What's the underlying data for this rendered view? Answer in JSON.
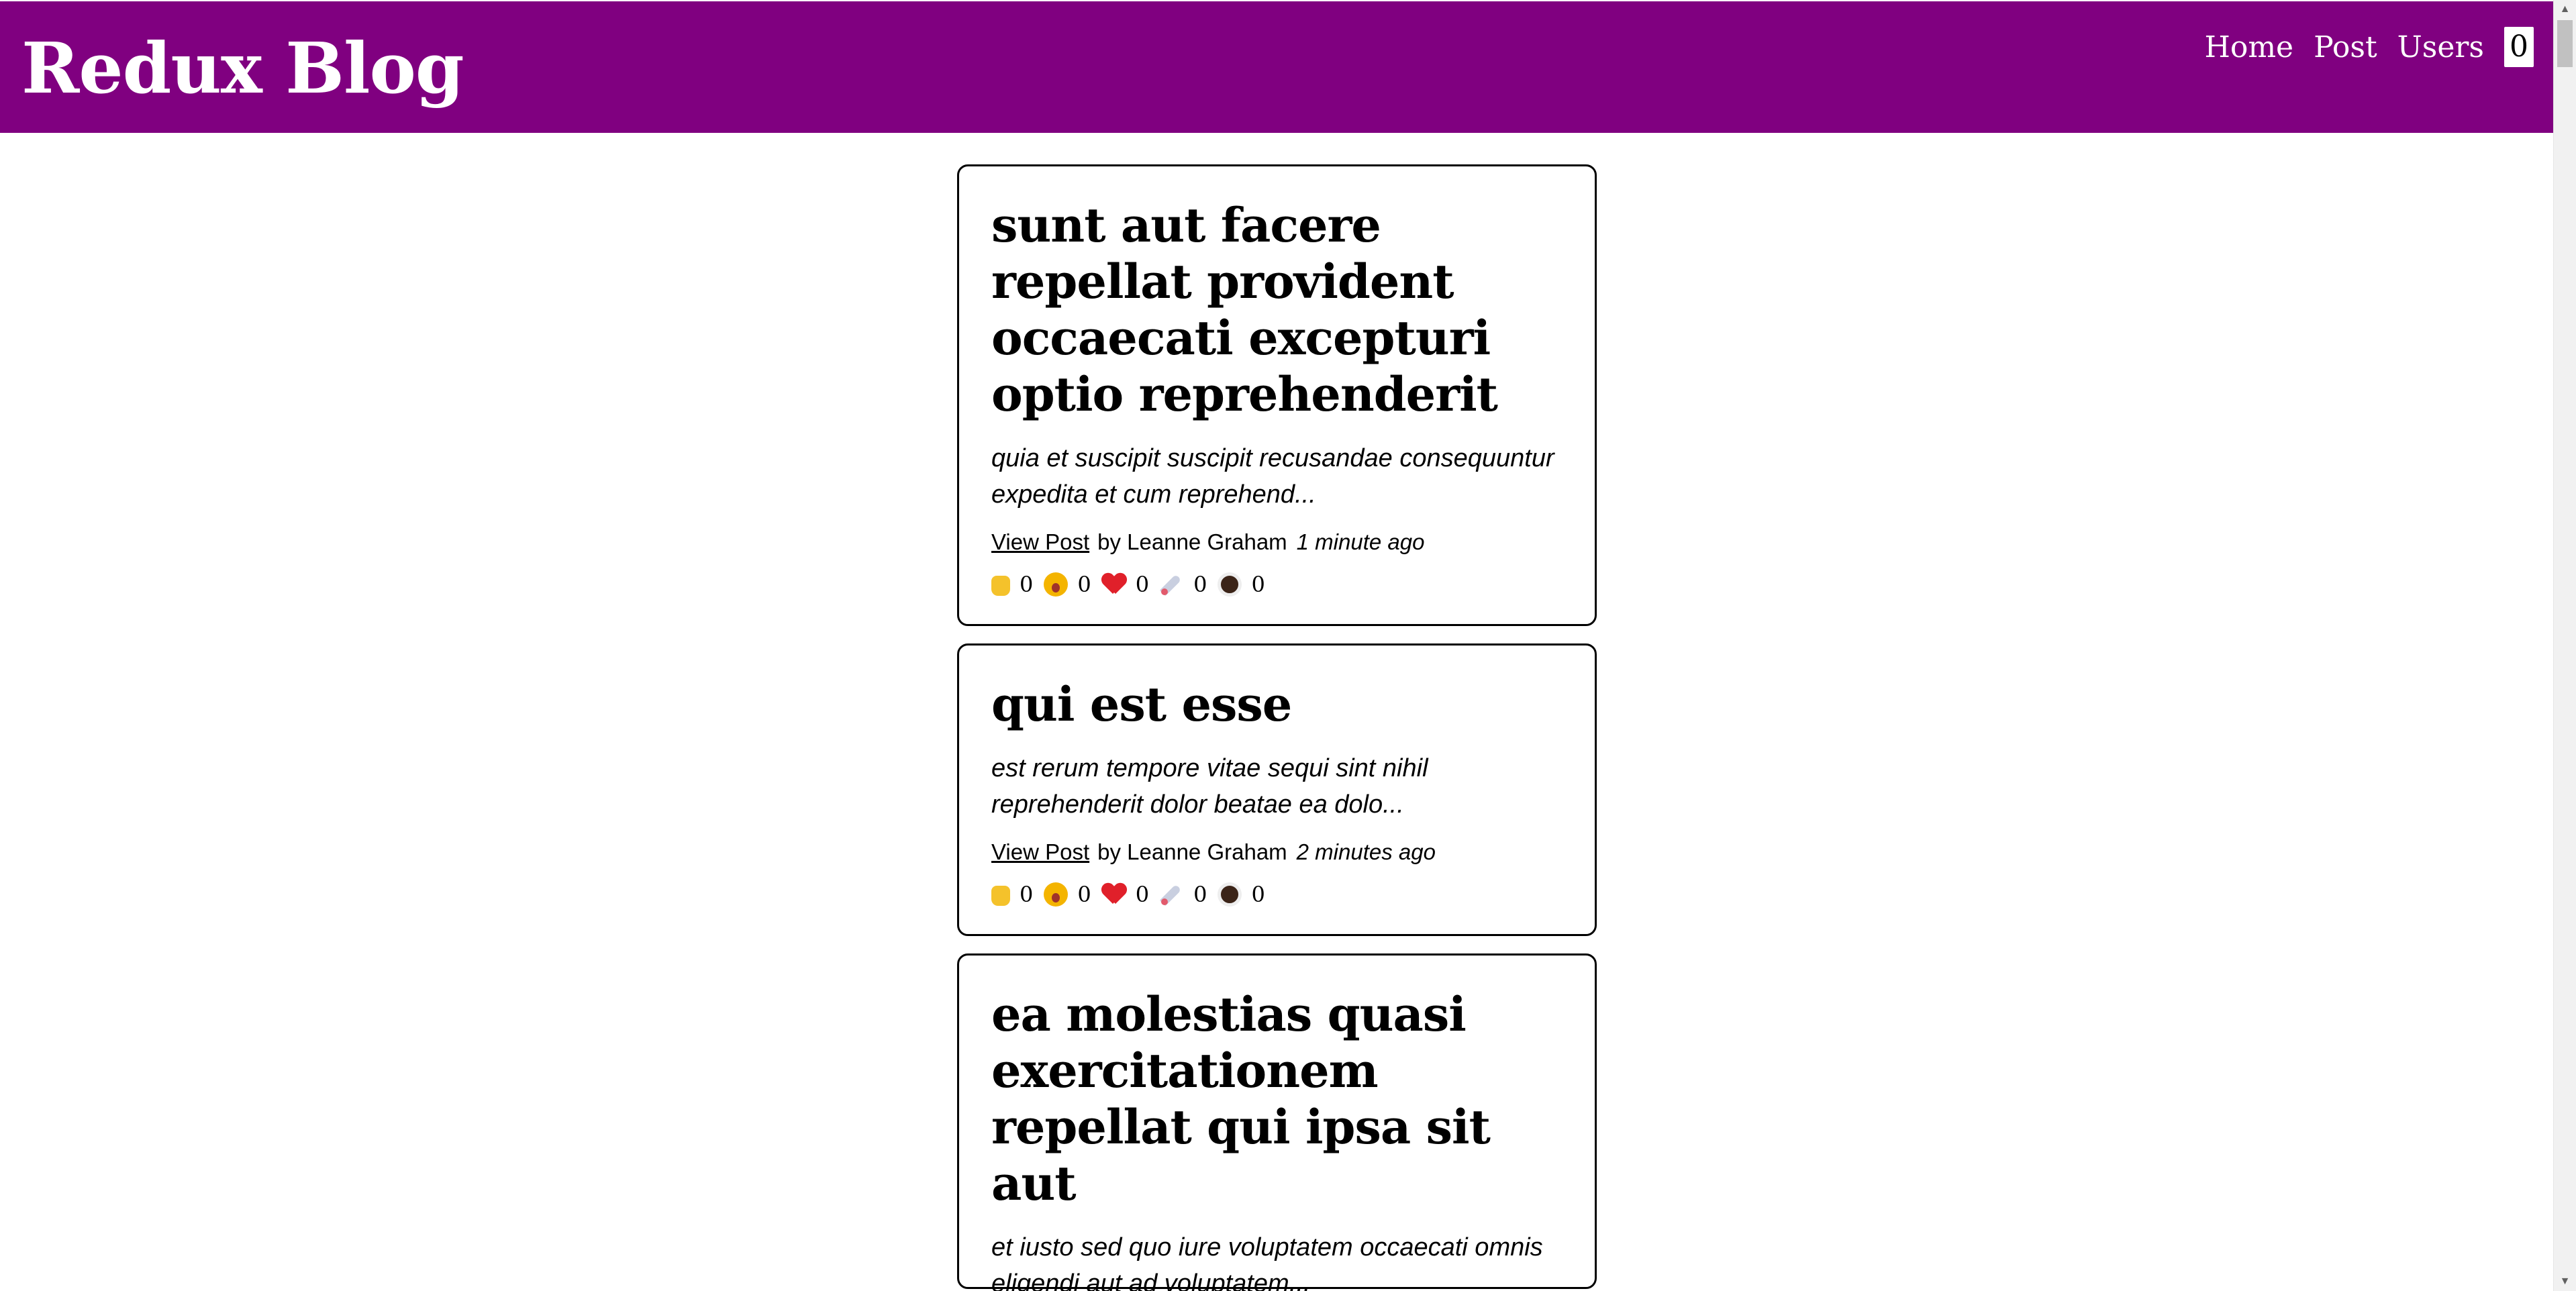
{
  "header": {
    "title": "Redux Blog",
    "nav": [
      {
        "label": "Home"
      },
      {
        "label": "Post"
      },
      {
        "label": "Users"
      }
    ],
    "count": "0"
  },
  "posts": [
    {
      "title": "sunt aut facere repellat provident occaecati excepturi optio reprehenderit",
      "excerpt": "quia et suscipit suscipit recusandae consequuntur expedita et cum reprehend...",
      "view_label": "View Post",
      "author": "by Leanne Graham",
      "time": "1 minute ago",
      "reactions": [
        {
          "icon": "thumbs-up-icon",
          "count": "0"
        },
        {
          "icon": "wow-face-icon",
          "count": "0"
        },
        {
          "icon": "heart-icon",
          "count": "0"
        },
        {
          "icon": "rocket-icon",
          "count": "0"
        },
        {
          "icon": "coffee-icon",
          "count": "0"
        }
      ]
    },
    {
      "title": "qui est esse",
      "excerpt": "est rerum tempore vitae sequi sint nihil reprehenderit dolor beatae ea dolo...",
      "view_label": "View Post",
      "author": "by Leanne Graham",
      "time": "2 minutes ago",
      "reactions": [
        {
          "icon": "thumbs-up-icon",
          "count": "0"
        },
        {
          "icon": "wow-face-icon",
          "count": "0"
        },
        {
          "icon": "heart-icon",
          "count": "0"
        },
        {
          "icon": "rocket-icon",
          "count": "0"
        },
        {
          "icon": "coffee-icon",
          "count": "0"
        }
      ]
    },
    {
      "title": "ea molestias quasi exercitationem repellat qui ipsa sit aut",
      "excerpt": "et iusto sed quo iure voluptatem occaecati omnis eligendi aut ad voluptatem..."
    }
  ],
  "colors": {
    "header_bg": "#800080",
    "header_text": "#ffffff",
    "card_border": "#000000"
  }
}
